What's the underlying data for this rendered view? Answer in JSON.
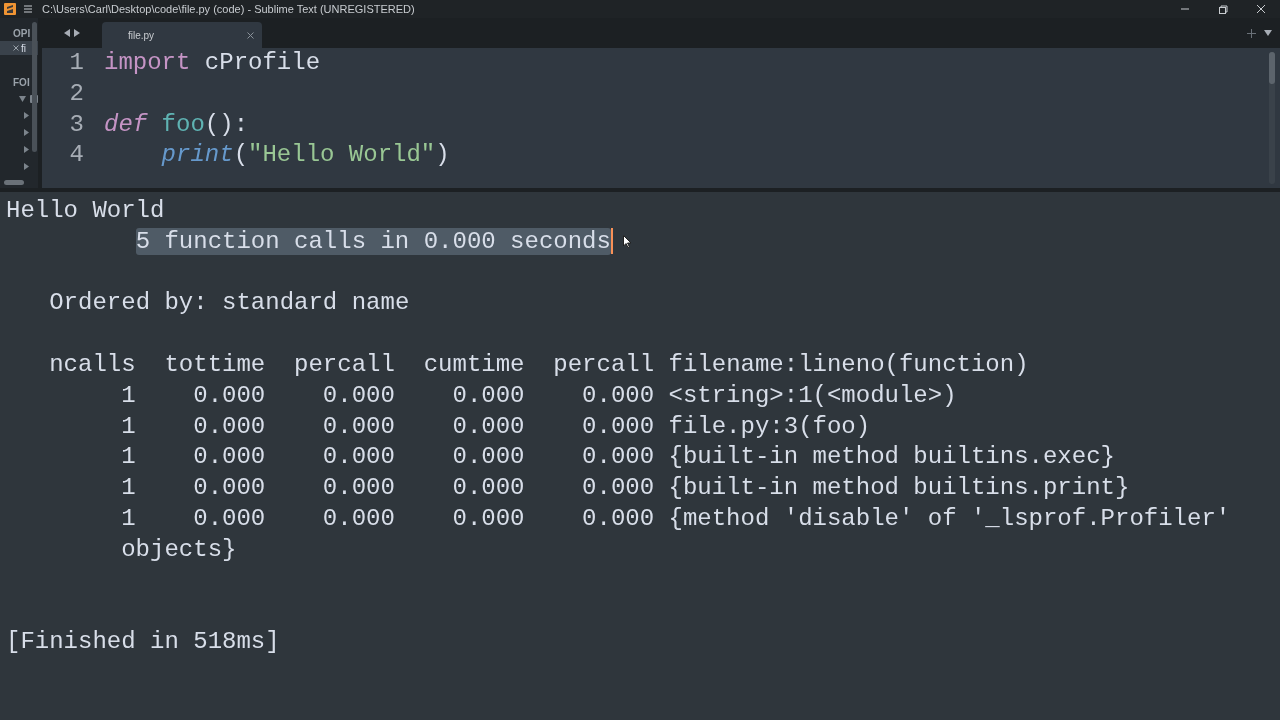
{
  "window": {
    "title": "C:\\Users\\Carl\\Desktop\\code\\file.py (code) - Sublime Text (UNREGISTERED)"
  },
  "sidebar": {
    "open_files_header": "OPI",
    "open_files": [
      {
        "label": "fi",
        "selected": true
      }
    ],
    "folders_header": "FOI",
    "tree": [
      {
        "expanded": true,
        "children": [
          {
            "expanded": false
          },
          {
            "expanded": false
          },
          {
            "expanded": false
          },
          {
            "expanded": false
          }
        ]
      }
    ]
  },
  "tabs": [
    {
      "label": "file.py",
      "selected": true
    }
  ],
  "editor": {
    "lines": [
      {
        "number": "1",
        "tokens": [
          {
            "kind": "keyword",
            "text": "import"
          },
          {
            "kind": "plain",
            "text": " cProfile"
          }
        ]
      },
      {
        "number": "2"
      },
      {
        "number": "3",
        "tokens": [
          {
            "kind": "storage",
            "text": "def"
          },
          {
            "kind": "function",
            "text": " foo"
          },
          {
            "kind": "plain",
            "text": "():"
          }
        ]
      },
      {
        "number": "4",
        "tokens": [
          {
            "kind": "builtin",
            "text": "    print"
          },
          {
            "kind": "plain",
            "text": "("
          },
          {
            "kind": "string",
            "text": "\"Hello World\""
          },
          {
            "kind": "plain",
            "text": ")"
          }
        ]
      }
    ]
  },
  "output": {
    "lines": [
      {
        "kind": "text",
        "text": "Hello World"
      },
      {
        "kind": "text",
        "text": "         5 function calls in 0.000 seconds",
        "selected": true
      },
      {
        "kind": "blank"
      },
      {
        "kind": "text",
        "text": "   Ordered by: standard name"
      },
      {
        "kind": "blank"
      },
      {
        "kind": "text",
        "text": "   ncalls  tottime  percall  cumtime  percall filename:lineno(function)"
      },
      {
        "kind": "text",
        "text": "        1    0.000    0.000    0.000    0.000 <string>:1(<module>)"
      },
      {
        "kind": "text",
        "text": "        1    0.000    0.000    0.000    0.000 file.py:3(foo)"
      },
      {
        "kind": "text",
        "text": "        1    0.000    0.000    0.000    0.000 {built-in method builtins.exec}"
      },
      {
        "kind": "text",
        "text": "        1    0.000    0.000    0.000    0.000 {built-in method builtins.print}"
      },
      {
        "kind": "text",
        "text": "        1    0.000    0.000    0.000    0.000 {method 'disable' of '_lsprof.Profiler'"
      },
      {
        "kind": "text",
        "text": "        objects}"
      },
      {
        "kind": "blank"
      },
      {
        "kind": "blank"
      },
      {
        "kind": "text",
        "text": "[Finished in 518ms]"
      }
    ]
  }
}
